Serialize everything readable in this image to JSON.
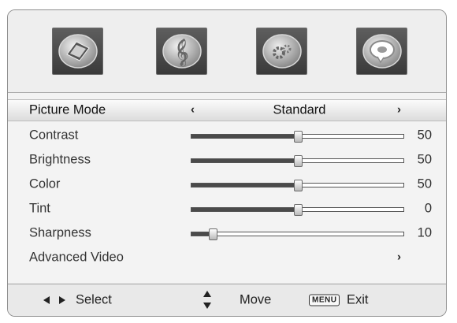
{
  "icons": [
    {
      "name": "picture-icon"
    },
    {
      "name": "sound-icon"
    },
    {
      "name": "setup-icon"
    },
    {
      "name": "parental-icon"
    }
  ],
  "menu": {
    "picture_mode": {
      "label": "Picture Mode",
      "value": "Standard"
    },
    "items": [
      {
        "label": "Contrast",
        "value": "50",
        "level": 0.5
      },
      {
        "label": "Brightness",
        "value": "50",
        "level": 0.5
      },
      {
        "label": "Color",
        "value": "50",
        "level": 0.5
      },
      {
        "label": "Tint",
        "value": "0",
        "level": 0.5
      },
      {
        "label": "Sharpness",
        "value": "10",
        "level": 0.1
      }
    ],
    "advanced": {
      "label": "Advanced Video"
    }
  },
  "footer": {
    "select_label": "Select",
    "move_label": "Move",
    "menu_key": "MENU",
    "exit_label": "Exit"
  }
}
